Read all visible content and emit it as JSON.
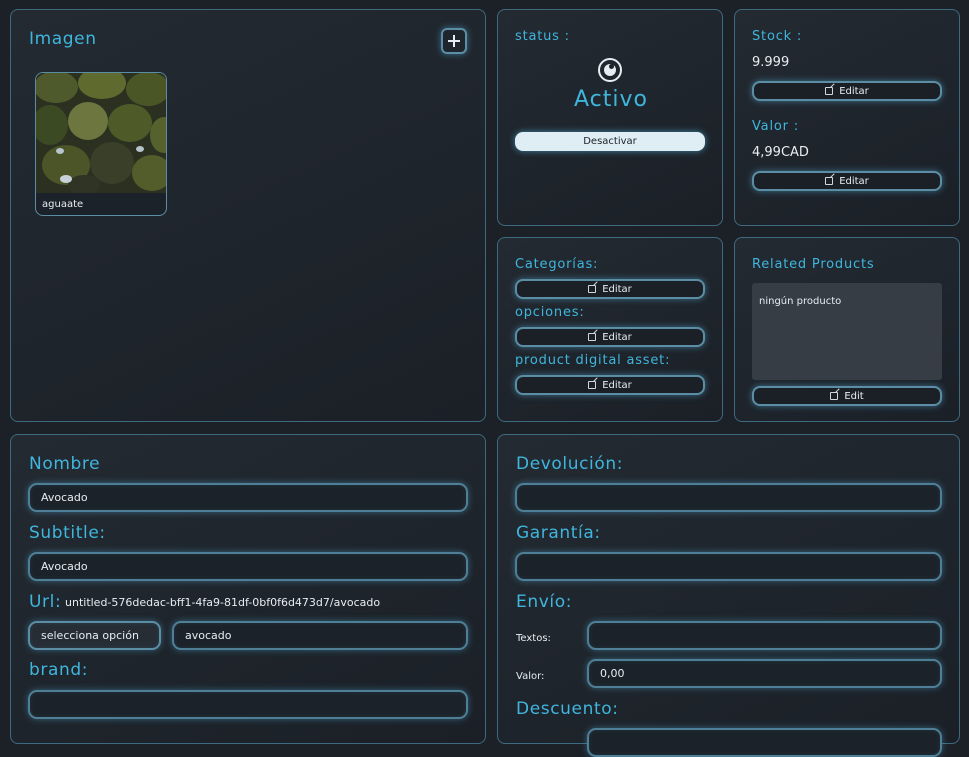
{
  "image_section": {
    "title": "Imagen",
    "add_icon": "plus-icon",
    "thumbnail_caption": "aguaate"
  },
  "status": {
    "label": "status :",
    "icon": "eye-icon",
    "value": "Activo",
    "button_label": "Desactivar"
  },
  "stock": {
    "label": "Stock :",
    "value": "9.999",
    "edit_label": "Editar",
    "valor_label": "Valor :",
    "valor_value": "4,99CAD",
    "valor_edit_label": "Editar"
  },
  "categories": {
    "categorias_label": "Categorías:",
    "categorias_edit": "Editar",
    "opciones_label": "opciones:",
    "opciones_edit": "Editar",
    "asset_label": "product digital asset:",
    "asset_edit": "Editar"
  },
  "related": {
    "title": "Related Products",
    "empty_text": "ningún producto",
    "edit_label": "Edit"
  },
  "details": {
    "nombre_label": "Nombre",
    "nombre_value": "Avocado",
    "subtitle_label": "Subtitle:",
    "subtitle_value": "Avocado",
    "url_label": "Url:",
    "url_value": "untitled-576dedac-bff1-4fa9-81df-0bf0f6d473d7/avocado",
    "select_option": "selecciona opción",
    "slug_value": "avocado",
    "brand_label": "brand:",
    "brand_value": ""
  },
  "policies": {
    "devolucion_label": "Devolución:",
    "devolucion_value": "",
    "garantia_label": "Garantía:",
    "garantia_value": "",
    "envio_label": "Envío:",
    "textos_label": "Textos:",
    "textos_value": "",
    "valor_label": "Valor:",
    "valor_value": "0,00",
    "descuento_label": "Descuento:"
  },
  "colors": {
    "accent": "#3fb6dd",
    "background": "#1c2128",
    "panel_border": "#3e6a7f",
    "glow": "#50afdc"
  }
}
